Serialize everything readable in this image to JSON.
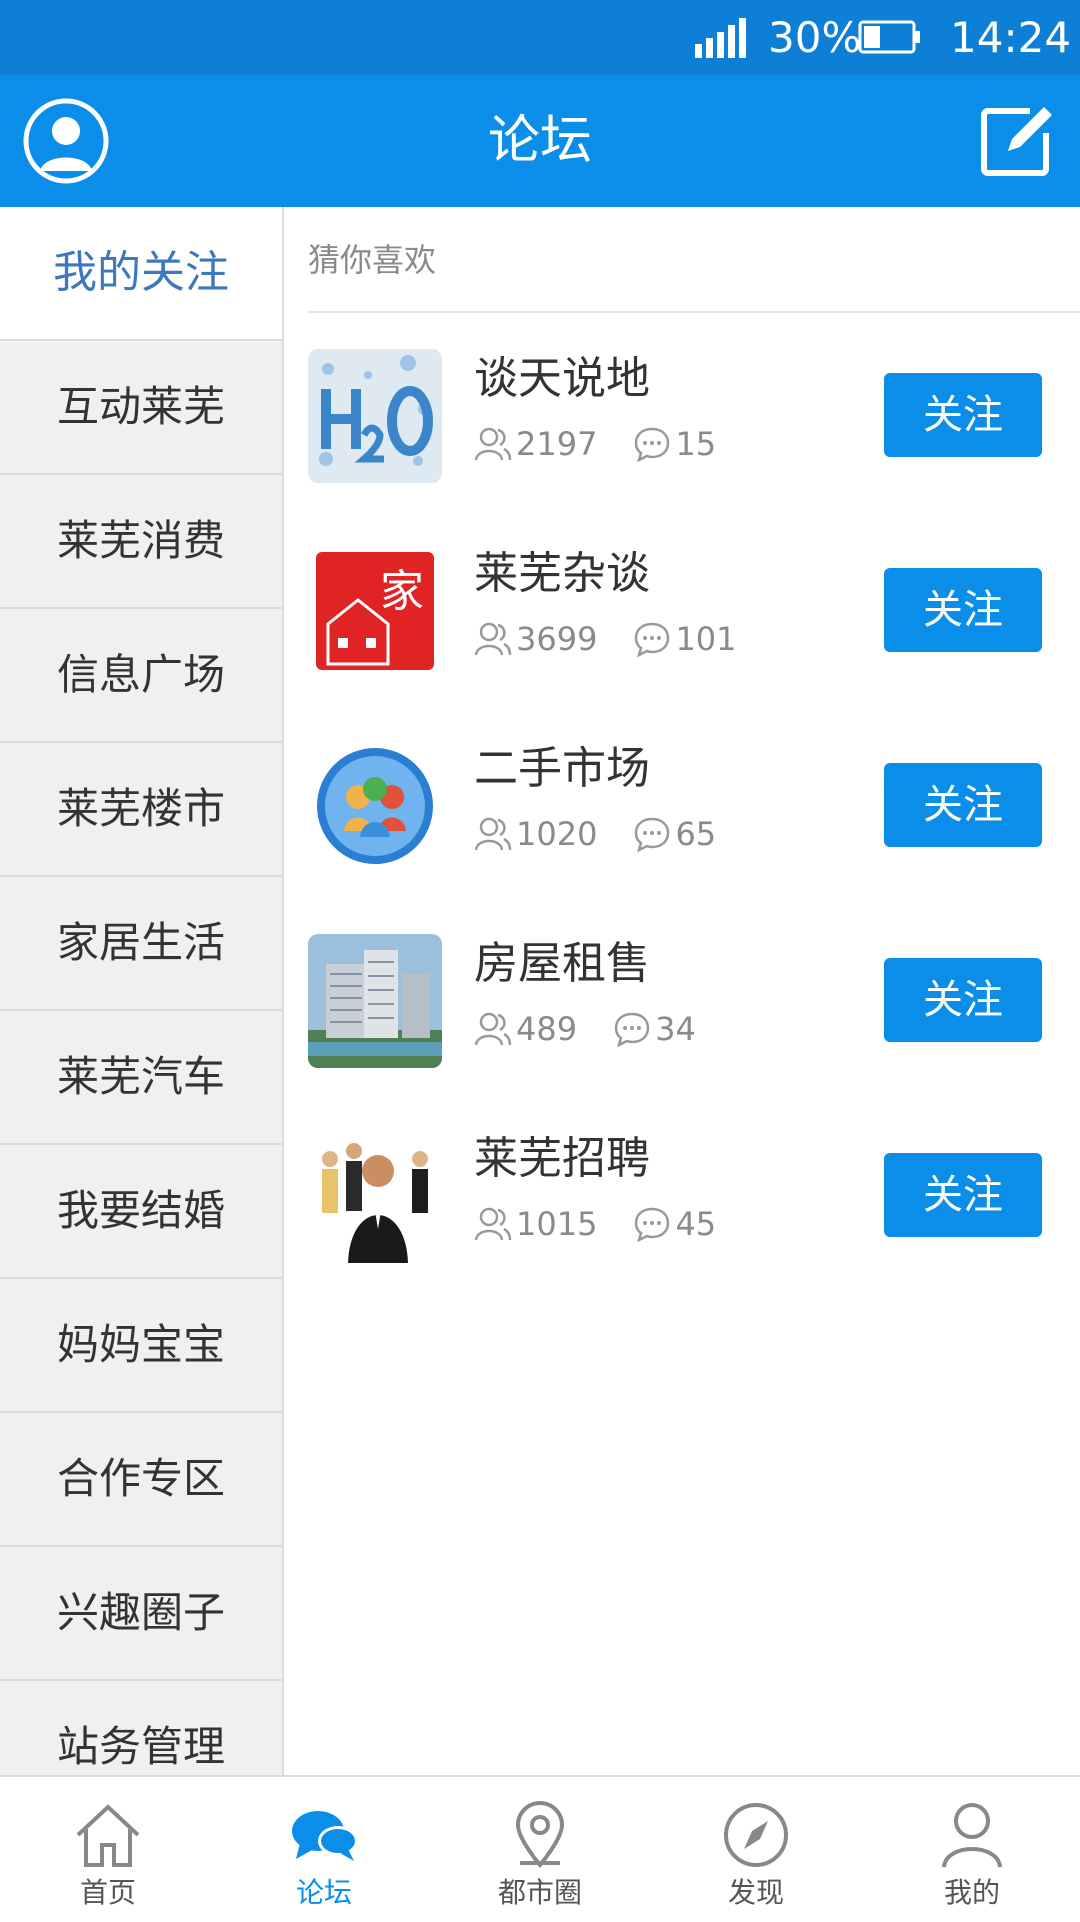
{
  "status_bar": {
    "battery": "30%",
    "time": "14:24"
  },
  "header": {
    "title": "论坛"
  },
  "sidebar": {
    "selected": "我的关注",
    "items": [
      {
        "label": "互动莱芜"
      },
      {
        "label": "莱芜消费"
      },
      {
        "label": "信息广场"
      },
      {
        "label": "莱芜楼市"
      },
      {
        "label": "家居生活"
      },
      {
        "label": "莱芜汽车"
      },
      {
        "label": "我要结婚"
      },
      {
        "label": "妈妈宝宝"
      },
      {
        "label": "合作专区"
      },
      {
        "label": "兴趣圈子"
      },
      {
        "label": "站务管理"
      }
    ]
  },
  "main": {
    "section_label": "猜你喜欢",
    "forums": [
      {
        "name": "谈天说地",
        "members": "2197",
        "posts": "15",
        "follow_label": "关注"
      },
      {
        "name": "莱芜杂谈",
        "members": "3699",
        "posts": "101",
        "follow_label": "关注"
      },
      {
        "name": "二手市场",
        "members": "1020",
        "posts": "65",
        "follow_label": "关注"
      },
      {
        "name": "房屋租售",
        "members": "489",
        "posts": "34",
        "follow_label": "关注"
      },
      {
        "name": "莱芜招聘",
        "members": "1015",
        "posts": "45",
        "follow_label": "关注"
      }
    ]
  },
  "tabbar": {
    "tabs": [
      {
        "label": "首页",
        "icon": "home-icon"
      },
      {
        "label": "论坛",
        "icon": "chat-bubble-icon"
      },
      {
        "label": "都市圈",
        "icon": "location-pin-icon"
      },
      {
        "label": "发现",
        "icon": "compass-icon"
      },
      {
        "label": "我的",
        "icon": "person-icon"
      }
    ],
    "active": "论坛"
  },
  "colors": {
    "brand_blue": "#0b8ee9",
    "status_blue": "#0d7fd6",
    "sidebar_bg": "#f0f0f0",
    "selected_text": "#3c77c0"
  }
}
